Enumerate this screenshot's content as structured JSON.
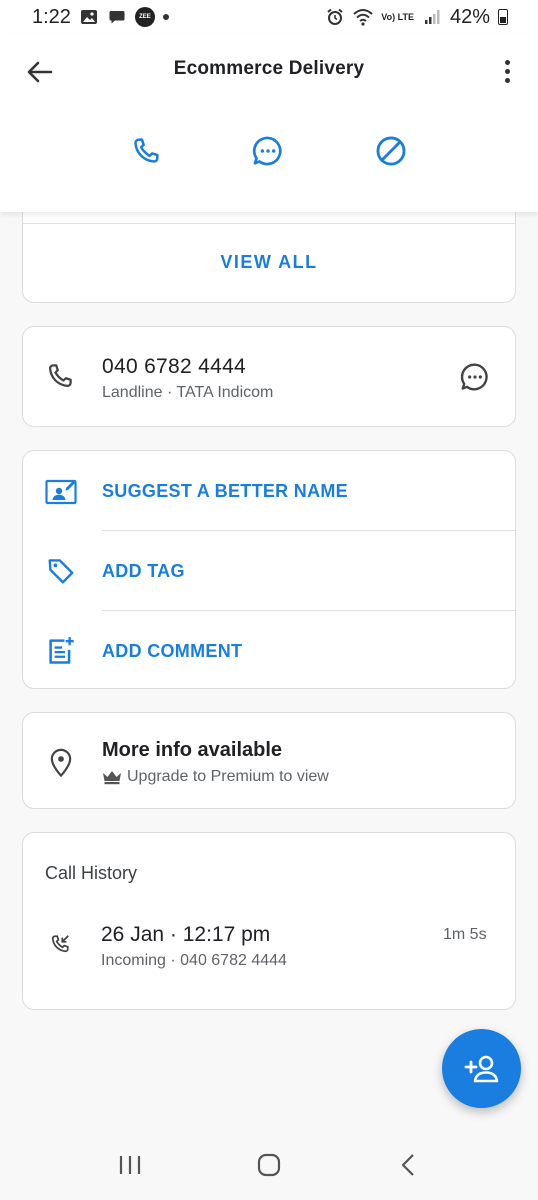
{
  "status_bar": {
    "time": "1:22",
    "battery": "42%",
    "network_label": "Vo) LTE",
    "zee_label": "ZEE"
  },
  "header": {
    "title": "Ecommerce Delivery",
    "actions": [
      "phone-icon",
      "message-icon",
      "block-icon"
    ]
  },
  "top_card": {
    "view_all_label": "VIEW ALL"
  },
  "phone_card": {
    "number": "040 6782 4444",
    "meta": "Landline · TATA Indicom"
  },
  "actions_card": {
    "items": [
      {
        "label": "SUGGEST A BETTER NAME",
        "icon": "suggest-name-icon"
      },
      {
        "label": "ADD TAG",
        "icon": "tag-icon"
      },
      {
        "label": "ADD COMMENT",
        "icon": "add-comment-icon"
      }
    ]
  },
  "info_card": {
    "title": "More info available",
    "subtitle": "Upgrade to Premium to view"
  },
  "history_card": {
    "title": "Call History",
    "entries": [
      {
        "date": "26 Jan · 12:17 pm",
        "meta": "Incoming · 040 6782 4444",
        "duration": "1m 5s"
      }
    ]
  },
  "colors": {
    "accent": "#1a7ee0",
    "text_primary": "#202124",
    "text_secondary": "#5f6368"
  }
}
